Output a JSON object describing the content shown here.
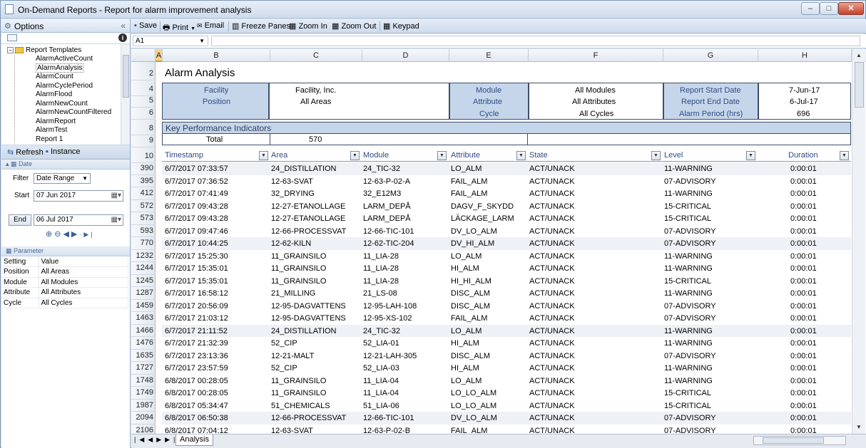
{
  "window": {
    "title": "On-Demand Reports - Report for alarm improvement analysis"
  },
  "left_panel": {
    "options_label": "Options",
    "tree": {
      "root": "Report Templates",
      "items": [
        "AlarmActiveCount",
        "AlarmAnalysis",
        "AlarmCount",
        "AlarmCyclePeriod",
        "AlarmFlood",
        "AlarmNewCount",
        "AlarmNewCountFiltered",
        "AlarmReport",
        "AlarmTest",
        "Report 1"
      ],
      "selected": "AlarmAnalysis"
    },
    "refresh_label": "Refresh",
    "instance_label": "Instance",
    "date_group": "Date",
    "filter_label": "Filter",
    "filter_value": "Date Range",
    "start_label": "Start",
    "start_value": "07 Jun 2017",
    "end_label": "End",
    "end_value": "06 Jul 2017",
    "parameter_group": "Parameter",
    "parameters": {
      "headers": [
        "Setting",
        "Value"
      ],
      "rows": [
        [
          "Position",
          "All Areas"
        ],
        [
          "Module",
          "All Modules"
        ],
        [
          "Attribute",
          "All Attributes"
        ],
        [
          "Cycle",
          "All Cycles"
        ]
      ]
    }
  },
  "toolbar": {
    "save": "Save",
    "print": "Print",
    "email": "Email",
    "freeze": "Freeze Panes",
    "zoom_in": "Zoom In",
    "zoom_out": "Zoom Out",
    "keypad": "Keypad"
  },
  "formula_bar": {
    "cell_ref": "A1",
    "formula": ""
  },
  "sheet": {
    "columns": [
      "A",
      "B",
      "C",
      "D",
      "E",
      "F",
      "G",
      "H"
    ],
    "row_numbers": [
      "2",
      "4",
      "5",
      "6",
      "8",
      "9",
      "10",
      "390",
      "395",
      "412",
      "572",
      "573",
      "593",
      "770",
      "1232",
      "1244",
      "1245",
      "1287",
      "1459",
      "1463",
      "1466",
      "1476",
      "1635",
      "1727",
      "1748",
      "1749",
      "1987",
      "2094",
      "2106"
    ],
    "title": "Alarm Analysis",
    "info": {
      "facility_label": "Facility",
      "facility_value": "Facility, Inc.",
      "position_label": "Position",
      "position_value": "All Areas",
      "module_label": "Module",
      "module_value": "All Modules",
      "attribute_label": "Attribute",
      "attribute_value": "All Attributes",
      "cycle_label": "Cycle",
      "cycle_value": "All Cycles",
      "start_date_label": "Report Start Date",
      "start_date_value": "7-Jun-17",
      "end_date_label": "Report End Date",
      "end_date_value": "6-Jul-17",
      "period_label": "Alarm Period (hrs)",
      "period_value": "696"
    },
    "kpi_title": "Key Performance Indicators",
    "kpi_total_label": "Total",
    "kpi_total_value": "570",
    "table_headers": [
      "Timestamp",
      "Area",
      "Module",
      "Attribute",
      "State",
      "Level",
      "Duration"
    ],
    "rows": [
      [
        "6/7/2017 07:33:57",
        "24_DISTILLATION",
        "24_TIC-32",
        "LO_ALM",
        "ACT/UNACK",
        "11-WARNING",
        "0:00:01"
      ],
      [
        "6/7/2017 07:36:52",
        "12-63-SVAT",
        "12-63-P-02-A",
        "FAIL_ALM",
        "ACT/UNACK",
        "07-ADVISORY",
        "0:00:01"
      ],
      [
        "6/7/2017 07:41:49",
        "32_DRYING",
        "32_E12M3",
        "FAIL_ALM",
        "ACT/UNACK",
        "11-WARNING",
        "0:00:01"
      ],
      [
        "6/7/2017 09:43:28",
        "12-27-ETANOLLAGE",
        "LARM_DEPÅ",
        "DAGV_F_SKYDD",
        "ACT/UNACK",
        "15-CRITICAL",
        "0:00:01"
      ],
      [
        "6/7/2017 09:43:28",
        "12-27-ETANOLLAGE",
        "LARM_DEPÅ",
        "LÄCKAGE_LARM",
        "ACT/UNACK",
        "15-CRITICAL",
        "0:00:01"
      ],
      [
        "6/7/2017 09:47:46",
        "12-66-PROCESSVAT",
        "12-66-TIC-101",
        "DV_LO_ALM",
        "ACT/UNACK",
        "07-ADVISORY",
        "0:00:01"
      ],
      [
        "6/7/2017 10:44:25",
        "12-62-KILN",
        "12-62-TIC-204",
        "DV_HI_ALM",
        "ACT/UNACK",
        "07-ADVISORY",
        "0:00:01"
      ],
      [
        "6/7/2017 15:25:30",
        "11_GRAINSILO",
        "11_LIA-28",
        "LO_ALM",
        "ACT/UNACK",
        "11-WARNING",
        "0:00:01"
      ],
      [
        "6/7/2017 15:35:01",
        "11_GRAINSILO",
        "11_LIA-28",
        "HI_ALM",
        "ACT/UNACK",
        "11-WARNING",
        "0:00:01"
      ],
      [
        "6/7/2017 15:35:01",
        "11_GRAINSILO",
        "11_LIA-28",
        "HI_HI_ALM",
        "ACT/UNACK",
        "15-CRITICAL",
        "0:00:01"
      ],
      [
        "6/7/2017 16:58:12",
        "21_MILLING",
        "21_LS-08",
        "DISC_ALM",
        "ACT/UNACK",
        "11-WARNING",
        "0:00:01"
      ],
      [
        "6/7/2017 20:56:09",
        "12-95-DAGVATTENS",
        "12-95-LAH-108",
        "DISC_ALM",
        "ACT/UNACK",
        "07-ADVISORY",
        "0:00:01"
      ],
      [
        "6/7/2017 21:03:12",
        "12-95-DAGVATTENS",
        "12-95-XS-102",
        "FAIL_ALM",
        "ACT/UNACK",
        "07-ADVISORY",
        "0:00:01"
      ],
      [
        "6/7/2017 21:11:52",
        "24_DISTILLATION",
        "24_TIC-32",
        "LO_ALM",
        "ACT/UNACK",
        "11-WARNING",
        "0:00:01"
      ],
      [
        "6/7/2017 21:32:39",
        "52_CIP",
        "52_LIA-01",
        "HI_ALM",
        "ACT/UNACK",
        "11-WARNING",
        "0:00:01"
      ],
      [
        "6/7/2017 23:13:36",
        "12-21-MALT",
        "12-21-LAH-305",
        "DISC_ALM",
        "ACT/UNACK",
        "07-ADVISORY",
        "0:00:01"
      ],
      [
        "6/7/2017 23:57:59",
        "52_CIP",
        "52_LIA-03",
        "HI_ALM",
        "ACT/UNACK",
        "11-WARNING",
        "0:00:01"
      ],
      [
        "6/8/2017 00:28:05",
        "11_GRAINSILO",
        "11_LIA-04",
        "LO_ALM",
        "ACT/UNACK",
        "11-WARNING",
        "0:00:01"
      ],
      [
        "6/8/2017 00:28:05",
        "11_GRAINSILO",
        "11_LIA-04",
        "LO_LO_ALM",
        "ACT/UNACK",
        "15-CRITICAL",
        "0:00:01"
      ],
      [
        "6/8/2017 05:34:47",
        "51_CHEMICALS",
        "51_LIA-06",
        "LO_LO_ALM",
        "ACT/UNACK",
        "15-CRITICAL",
        "0:00:01"
      ],
      [
        "6/8/2017 06:50:38",
        "12-66-PROCESSVAT",
        "12-66-TIC-101",
        "DV_LO_ALM",
        "ACT/UNACK",
        "07-ADVISORY",
        "0:00:01"
      ],
      [
        "6/8/2017 07:04:12",
        "12-63-SVAT",
        "12-63-P-02-B",
        "FAIL_ALM",
        "ACT/UNACK",
        "07-ADVISORY",
        "0:00:01"
      ]
    ],
    "sheet_tab": "Analysis"
  }
}
